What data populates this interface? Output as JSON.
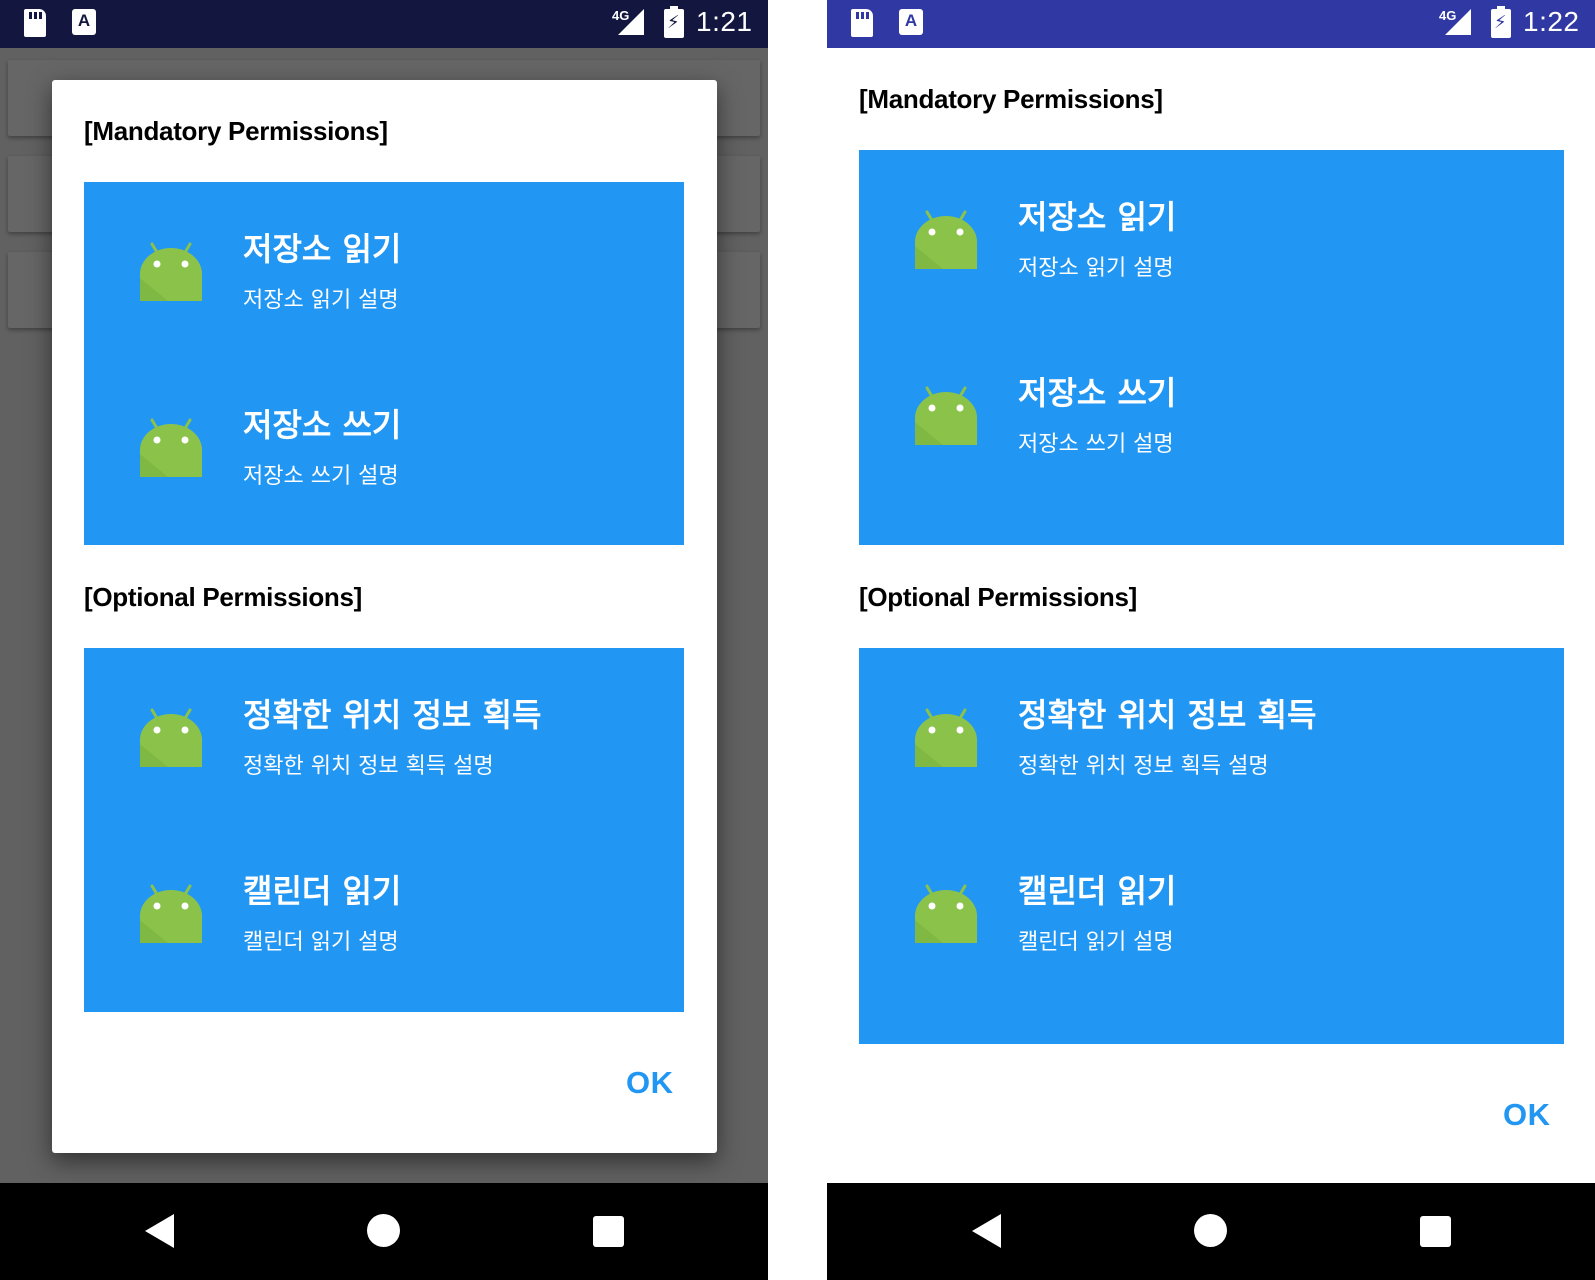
{
  "screens": [
    {
      "time": "1:21",
      "network": "4G",
      "mandatory_title": "[Mandatory Permissions]",
      "optional_title": "[Optional Permissions]",
      "mandatory": [
        {
          "title": "저장소 읽기",
          "desc": "저장소 읽기 설명",
          "icon": "android-icon"
        },
        {
          "title": "저장소 쓰기",
          "desc": "저장소 쓰기 설명",
          "icon": "android-icon"
        }
      ],
      "optional": [
        {
          "title": "정확한 위치 정보 획득",
          "desc": "정확한 위치 정보 획득 설명",
          "icon": "android-icon"
        },
        {
          "title": "캘린더 읽기",
          "desc": "캘린더 읽기 설명",
          "icon": "android-icon"
        }
      ],
      "ok_label": "OK"
    },
    {
      "time": "1:22",
      "network": "4G",
      "mandatory_title": "[Mandatory Permissions]",
      "optional_title": "[Optional Permissions]",
      "mandatory": [
        {
          "title": "저장소 읽기",
          "desc": "저장소 읽기 설명",
          "icon": "android-icon"
        },
        {
          "title": "저장소 쓰기",
          "desc": "저장소 쓰기 설명",
          "icon": "android-icon"
        }
      ],
      "optional": [
        {
          "title": "정확한 위치 정보 획득",
          "desc": "정확한 위치 정보 획득 설명",
          "icon": "android-icon"
        },
        {
          "title": "캘린더 읽기",
          "desc": "캘린더 읽기 설명",
          "icon": "android-icon"
        }
      ],
      "ok_label": "OK"
    }
  ],
  "colors": {
    "accent": "#2196f3",
    "android_green": "#8bc34a",
    "status_bar_left": "#13173f",
    "status_bar_right": "#3039a3"
  }
}
